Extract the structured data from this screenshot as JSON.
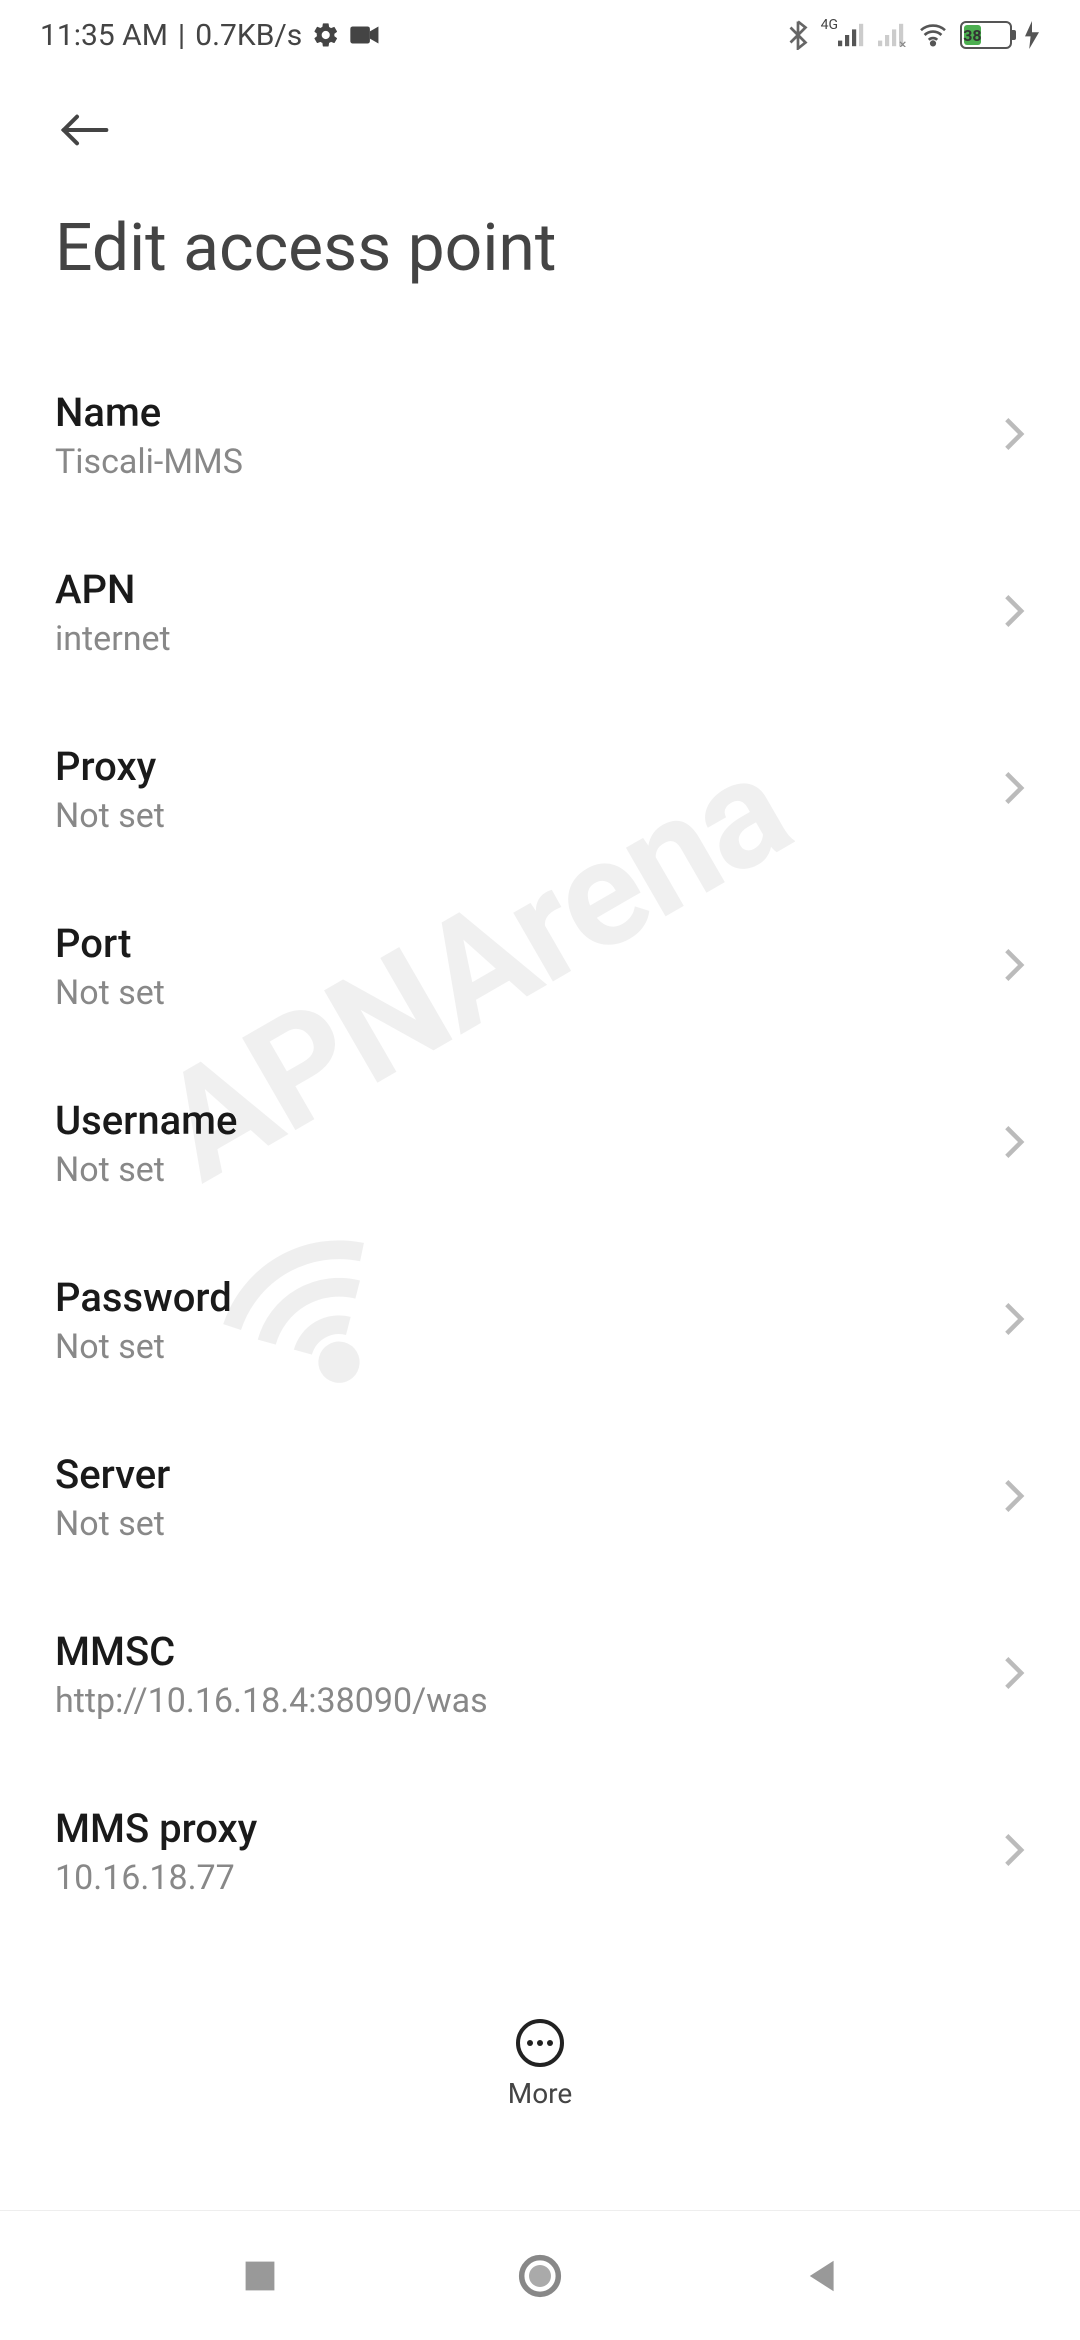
{
  "status": {
    "time": "11:35 AM",
    "rate": "0.7KB/s",
    "battery_pct": "38",
    "net_label": "4G"
  },
  "page": {
    "title": "Edit access point"
  },
  "settings": [
    {
      "label": "Name",
      "value": "Tiscali-MMS"
    },
    {
      "label": "APN",
      "value": "internet"
    },
    {
      "label": "Proxy",
      "value": "Not set"
    },
    {
      "label": "Port",
      "value": "Not set"
    },
    {
      "label": "Username",
      "value": "Not set"
    },
    {
      "label": "Password",
      "value": "Not set"
    },
    {
      "label": "Server",
      "value": "Not set"
    },
    {
      "label": "MMSC",
      "value": "http://10.16.18.4:38090/was"
    },
    {
      "label": "MMS proxy",
      "value": "10.16.18.77"
    }
  ],
  "bottom": {
    "more_label": "More"
  },
  "watermark": "APNArena"
}
